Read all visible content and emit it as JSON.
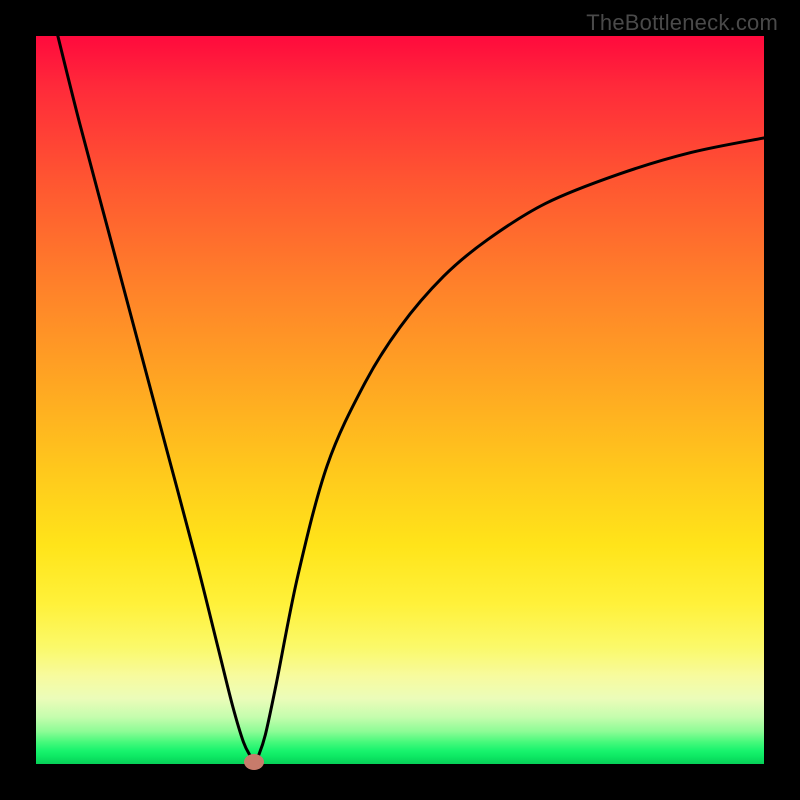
{
  "attribution": "TheBottleneck.com",
  "chart_data": {
    "type": "line",
    "title": "",
    "xlabel": "",
    "ylabel": "",
    "xlim": [
      0,
      100
    ],
    "ylim": [
      0,
      100
    ],
    "series": [
      {
        "name": "bottleneck-curve",
        "x": [
          3,
          6,
          10,
          14,
          18,
          22,
          25,
          27,
          28.5,
          29.5,
          30,
          30.5,
          31.5,
          33,
          36,
          40,
          45,
          50,
          56,
          62,
          70,
          80,
          90,
          100
        ],
        "values": [
          100,
          88,
          73,
          58,
          43,
          28,
          16,
          8,
          3,
          1,
          0,
          1,
          4,
          11,
          26,
          41,
          52,
          60,
          67,
          72,
          77,
          81,
          84,
          86
        ]
      }
    ],
    "marker": {
      "x": 30,
      "y": 0
    },
    "gradient_stops": [
      {
        "pos": 0,
        "color": "#ff0a3d"
      },
      {
        "pos": 7,
        "color": "#ff2a3a"
      },
      {
        "pos": 20,
        "color": "#ff5631"
      },
      {
        "pos": 34,
        "color": "#ff802a"
      },
      {
        "pos": 48,
        "color": "#ffa722"
      },
      {
        "pos": 60,
        "color": "#ffc91c"
      },
      {
        "pos": 70,
        "color": "#ffe41a"
      },
      {
        "pos": 78,
        "color": "#fff13a"
      },
      {
        "pos": 84,
        "color": "#fbf96a"
      },
      {
        "pos": 88,
        "color": "#f7fb9f"
      },
      {
        "pos": 91,
        "color": "#ebfcb9"
      },
      {
        "pos": 93.5,
        "color": "#c6fdae"
      },
      {
        "pos": 95.5,
        "color": "#8efc96"
      },
      {
        "pos": 97,
        "color": "#46f97b"
      },
      {
        "pos": 98.2,
        "color": "#18f36d"
      },
      {
        "pos": 99,
        "color": "#0de763"
      },
      {
        "pos": 100,
        "color": "#07cf58"
      }
    ]
  }
}
